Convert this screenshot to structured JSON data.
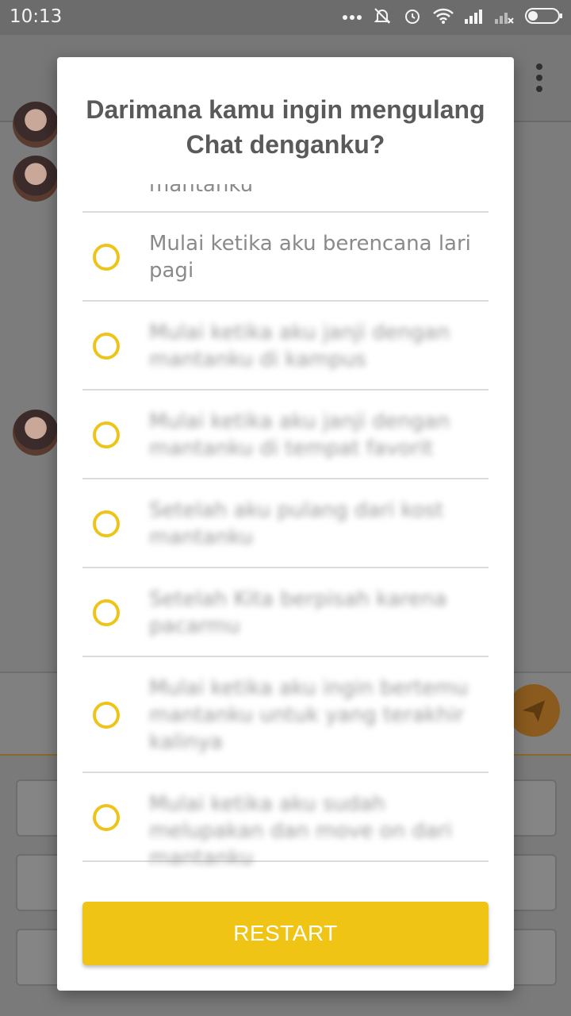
{
  "status_bar": {
    "time": "10:13",
    "icons": [
      "more-dots-icon",
      "notifications-off-icon",
      "alarm-icon",
      "wifi-icon",
      "signal-icon",
      "signal-no-service-icon",
      "battery-icon"
    ]
  },
  "dialog": {
    "title": "Darimana kamu ingin mengulang Chat denganku?",
    "options": [
      {
        "label": "mantanku"
      },
      {
        "label": "Mulai ketika aku berencana lari pagi"
      },
      {
        "label": "Mulai ketika aku janji dengan mantanku di kampus"
      },
      {
        "label": "Mulai ketika aku janji dengan mantanku di tempat favorit"
      },
      {
        "label": "Setelah aku pulang dari kost mantanku"
      },
      {
        "label": "Setelah Kita berpisah karena pacarmu"
      },
      {
        "label": "Mulai ketika aku ingin bertemu mantanku untuk yang terakhir kalinya"
      },
      {
        "label": "Mulai ketika aku sudah melupakan dan move on dari mantanku"
      }
    ],
    "restart_label": "RESTART"
  },
  "colors": {
    "accent": "#f0c414",
    "radio_border": "#efc318",
    "title_text": "#5a5a5a",
    "option_text": "#8a8a8a"
  }
}
